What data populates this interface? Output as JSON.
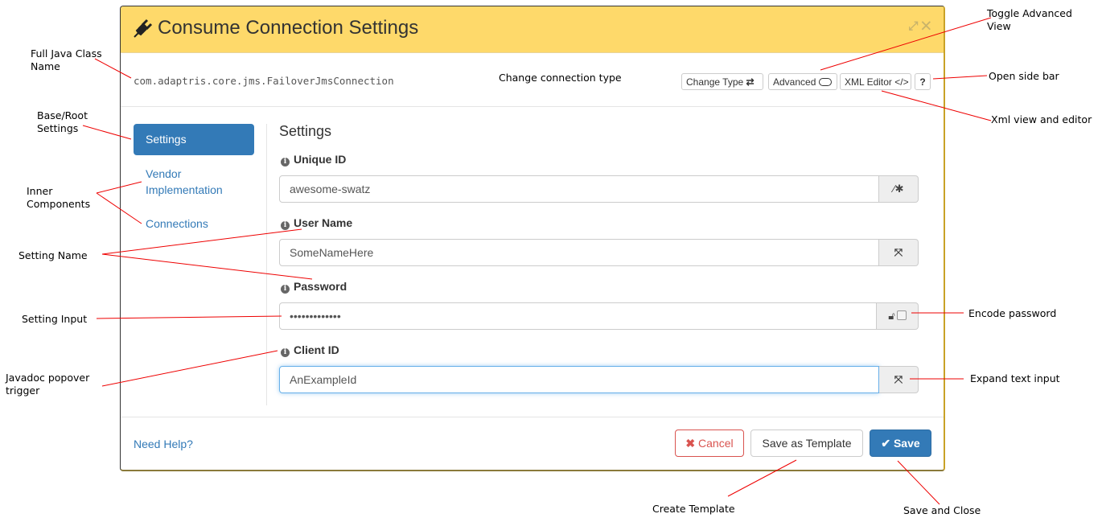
{
  "modal": {
    "title": "Consume Connection Settings",
    "title_icon": "plug-icon",
    "header_icons": [
      "expand-icon",
      "close-icon"
    ],
    "class_name": "com.adaptris.core.jms.FailoverJmsConnection",
    "toolbar": {
      "change_type": "Change Type",
      "advanced": "Advanced",
      "xml_editor": "XML Editor",
      "help": "?"
    },
    "nav": {
      "items": [
        {
          "label": "Settings",
          "active": true
        },
        {
          "label": "Vendor Implementation",
          "active": false
        },
        {
          "label": "Connections",
          "active": false
        }
      ]
    },
    "section_title": "Settings",
    "fields": [
      {
        "label": "Unique ID",
        "value": "awesome-swatz",
        "addon": "magic-wand-icon"
      },
      {
        "label": "User Name",
        "value": "SomeNameHere",
        "addon": "expand-icon"
      },
      {
        "label": "Password",
        "value": "•••••••••••••",
        "addon": "unlock-icon + checkbox"
      },
      {
        "label": "Client ID",
        "value": "AnExampleId",
        "addon": "expand-icon"
      }
    ],
    "footer": {
      "help_link": "Need Help?",
      "cancel": "Cancel",
      "save_template": "Save as Template",
      "save": "Save"
    },
    "colors": {
      "header": "#fed96a",
      "primary": "#337ab7",
      "danger": "#d9534f"
    }
  },
  "annotations": {
    "full_java_class_name": "Full Java Class Name",
    "base_root_settings": "Base/Root Settings",
    "inner_components": "Inner Components",
    "setting_name": "Setting Name",
    "setting_input": "Setting Input",
    "javadoc_popover": "Javadoc popover trigger",
    "change_connection_type": "Change connection type",
    "toggle_advanced": "Toggle Advanced View",
    "open_side_bar": "Open side bar",
    "xml_view": "Xml view and editor",
    "encode_password": "Encode password",
    "expand_text_input": "Expand text input",
    "create_template": "Create Template",
    "save_and_close": "Save and Close"
  }
}
